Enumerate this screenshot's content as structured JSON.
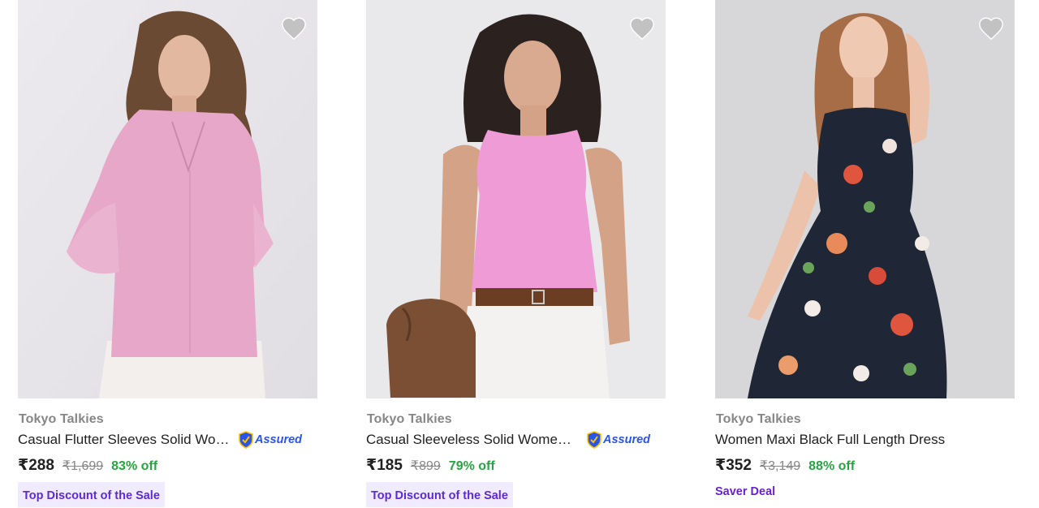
{
  "products": [
    {
      "brand": "Tokyo Talkies",
      "title": "Casual Flutter Sleeves Solid Women Pink Top",
      "assured": true,
      "assured_label": "Assured",
      "price": "₹288",
      "mrp": "₹1,699",
      "discount": "83% off",
      "tag": "Top Discount of the Sale",
      "image_icon": "pink-top-photo"
    },
    {
      "brand": "Tokyo Talkies",
      "title": "Casual Sleeveless Solid Women Pink Top",
      "assured": true,
      "assured_label": "Assured",
      "price": "₹185",
      "mrp": "₹899",
      "discount": "79% off",
      "tag": "Top Discount of the Sale",
      "image_icon": "pink-tank-top-photo"
    },
    {
      "brand": "Tokyo Talkies",
      "title": "Women Maxi Black Full Length Dress",
      "assured": false,
      "price": "₹352",
      "mrp": "₹3,149",
      "discount": "88% off",
      "tag": "Saver Deal",
      "image_icon": "floral-maxi-dress-photo"
    }
  ],
  "icons": {
    "wishlist": "heart-icon",
    "assured": "shield-icon"
  },
  "colors": {
    "brand_text": "#878787",
    "title_text": "#212121",
    "discount": "#26a541",
    "assured_blue": "#2a55e5",
    "tag_bg": "#f1ebff",
    "tag_text": "#5b2bd4",
    "heart": "#c2c2c2"
  }
}
